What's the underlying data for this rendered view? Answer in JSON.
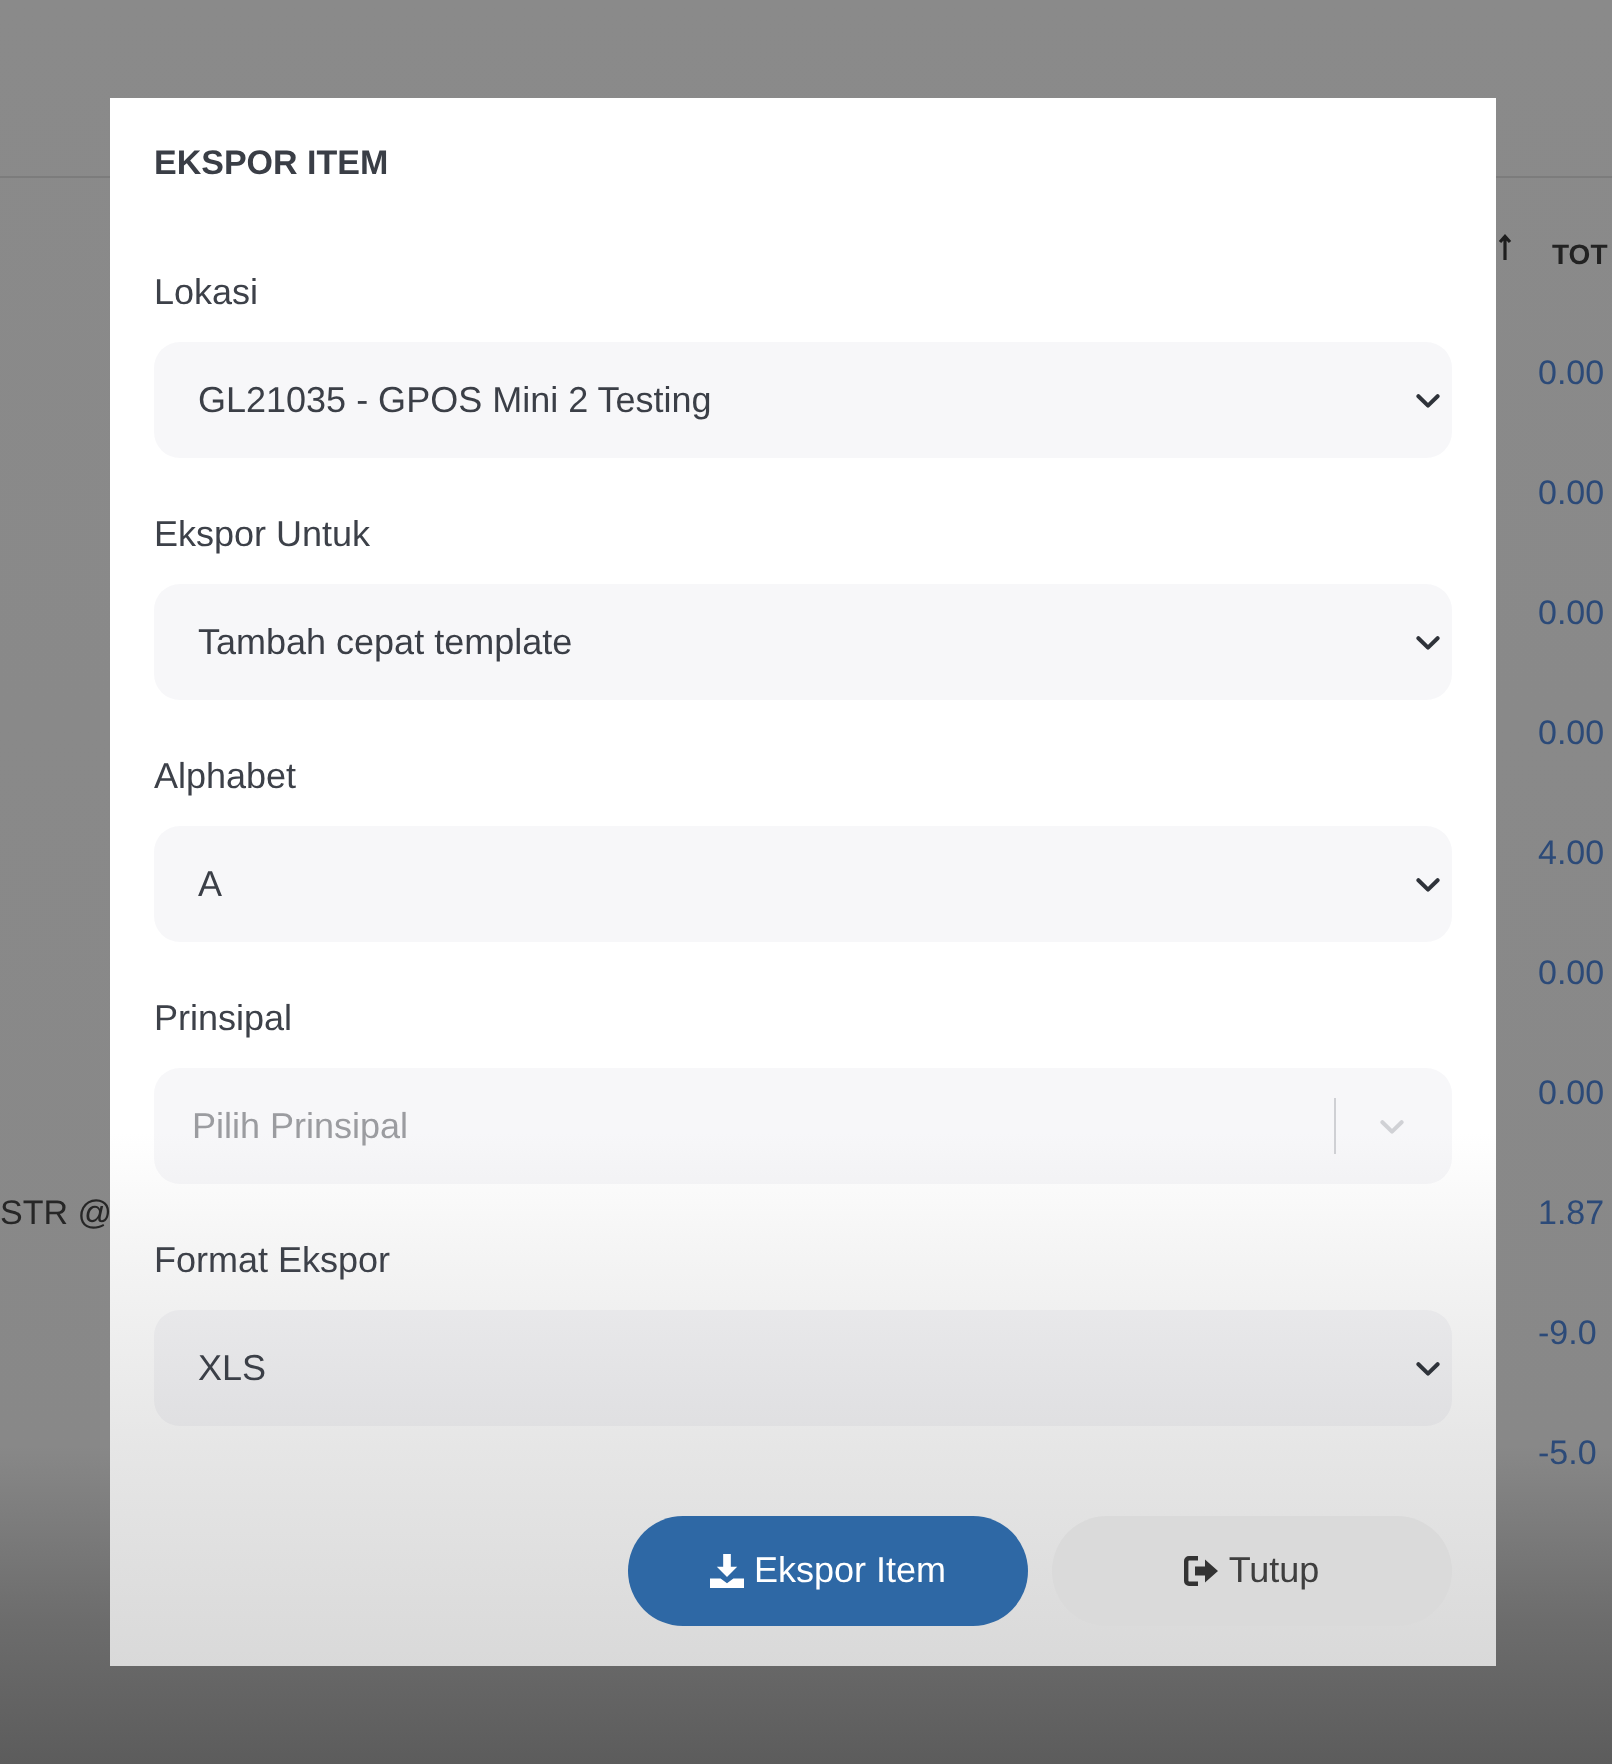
{
  "backdrop": {
    "column_header": "TOT",
    "rows": [
      {
        "amount": "0.00"
      },
      {
        "amount": "0.00"
      },
      {
        "amount": "0.00"
      },
      {
        "amount": "0.00"
      },
      {
        "amount": "4.00"
      },
      {
        "amount": "0.00"
      },
      {
        "amount": "0.00"
      },
      {
        "label": "STR @",
        "amount": "1.87"
      },
      {
        "amount": "-9.0"
      },
      {
        "amount": "-5.0"
      }
    ]
  },
  "dialog": {
    "title": "EKSPOR ITEM",
    "fields": [
      {
        "label": "Lokasi",
        "kind": "select",
        "value": "GL21035 - GPOS Mini 2 Testing"
      },
      {
        "label": "Ekspor Untuk",
        "kind": "select",
        "value": "Tambah cepat template"
      },
      {
        "label": "Alphabet",
        "kind": "select",
        "value": "A"
      },
      {
        "label": "Prinsipal",
        "kind": "searchable-select",
        "placeholder": "Pilih Prinsipal"
      },
      {
        "label": "Format Ekspor",
        "kind": "select",
        "value": "XLS"
      }
    ],
    "buttons": [
      {
        "label": "Ekspor Item",
        "kind": "primary"
      },
      {
        "label": "Tutup",
        "kind": "secondary"
      }
    ]
  }
}
